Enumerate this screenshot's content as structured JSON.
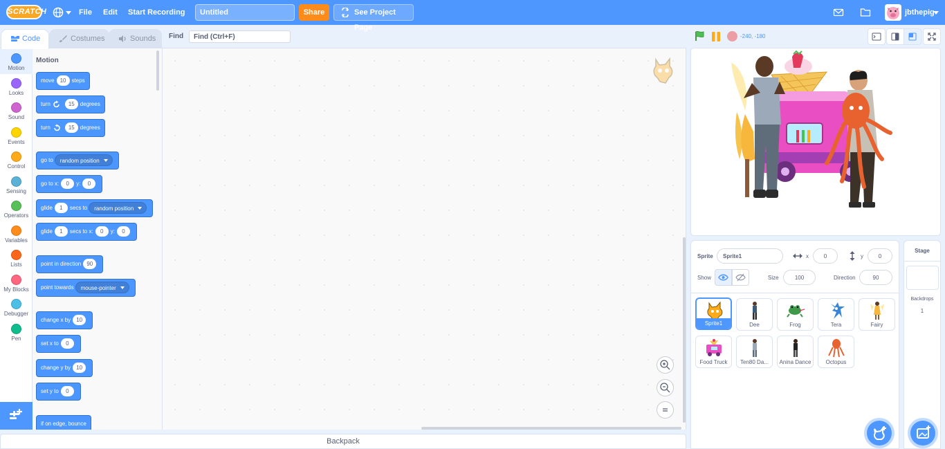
{
  "menu": {
    "logo": "SCRATCH",
    "file": "File",
    "edit": "Edit",
    "record": "Start Recording",
    "title_placeholder": "Untitled",
    "share": "Share",
    "see_project": "See Project Page",
    "username": "jbthepig"
  },
  "tabs": {
    "code": "Code",
    "costumes": "Costumes",
    "sounds": "Sounds"
  },
  "find": {
    "label": "Find",
    "placeholder": "Find (Ctrl+F)"
  },
  "categories": [
    {
      "name": "Motion",
      "color": "#4c97ff"
    },
    {
      "name": "Looks",
      "color": "#9966ff"
    },
    {
      "name": "Sound",
      "color": "#cf63cf"
    },
    {
      "name": "Events",
      "color": "#ffd500"
    },
    {
      "name": "Control",
      "color": "#ffab19"
    },
    {
      "name": "Sensing",
      "color": "#5cb1d6"
    },
    {
      "name": "Operators",
      "color": "#59c059"
    },
    {
      "name": "Variables",
      "color": "#ff8c1a"
    },
    {
      "name": "Lists",
      "color": "#ff661a"
    },
    {
      "name": "My Blocks",
      "color": "#ff6680"
    },
    {
      "name": "Debugger",
      "color": "#4cbfe6"
    },
    {
      "name": "Pen",
      "color": "#0fbd8c"
    }
  ],
  "palette": {
    "title": "Motion",
    "blocks": {
      "move": [
        "move",
        "10",
        "steps"
      ],
      "turn_cw": [
        "turn",
        "15",
        "degrees"
      ],
      "turn_ccw": [
        "turn",
        "15",
        "degrees"
      ],
      "goto": [
        "go to",
        "random position"
      ],
      "goto_xy": [
        "go to x:",
        "0",
        "y:",
        "0"
      ],
      "glide_to": [
        "glide",
        "1",
        "secs to",
        "random position"
      ],
      "glide_xy": [
        "glide",
        "1",
        "secs to x:",
        "0",
        "y:",
        "0"
      ],
      "point_dir": [
        "point in direction",
        "90"
      ],
      "point_towards": [
        "point towards",
        "mouse-pointer"
      ],
      "change_x": [
        "change x by",
        "10"
      ],
      "set_x": [
        "set x to",
        "0"
      ],
      "change_y": [
        "change y by",
        "10"
      ],
      "set_y": [
        "set y to",
        "0"
      ],
      "bounce": [
        "if on edge, bounce"
      ]
    }
  },
  "backpack": "Backpack",
  "stage_header": {
    "coords": "-240, -180"
  },
  "sprite_info": {
    "sprite_label": "Sprite",
    "sprite_name": "Sprite1",
    "x_label": "x",
    "x": "0",
    "y_label": "y",
    "y": "0",
    "show_label": "Show",
    "size_label": "Size",
    "size": "100",
    "direction_label": "Direction",
    "direction": "90"
  },
  "sprites": [
    "Sprite1",
    "Dee",
    "Frog",
    "Tera",
    "Fairy",
    "Food Truck",
    "Ten80 Da...",
    "Anina Dance",
    "Octopus"
  ],
  "stage_panel": {
    "title": "Stage",
    "backdrops_label": "Backdrops",
    "backdrops_count": "1"
  }
}
